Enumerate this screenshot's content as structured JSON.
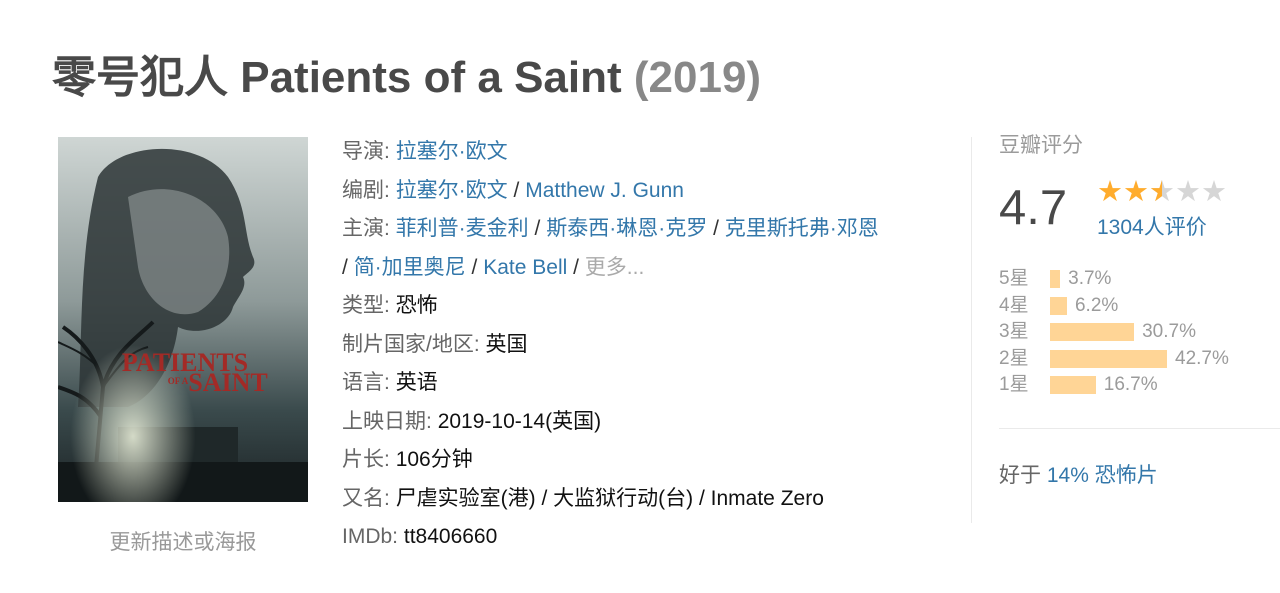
{
  "title": {
    "name": "零号犯人 Patients of a Saint",
    "year": "(2019)"
  },
  "poster": {
    "line1": "PATIENTS",
    "line2": "OF A",
    "line3": "SAINT",
    "update_link": "更新描述或海报"
  },
  "info": {
    "director_label": "导演:",
    "director": "拉塞尔·欧文",
    "writer_label": "编剧:",
    "writers": [
      "拉塞尔·欧文",
      "Matthew J. Gunn"
    ],
    "cast_label": "主演:",
    "cast": [
      "菲利普·麦金利",
      "斯泰西·琳恩·克罗",
      "克里斯托弗·邓恩",
      "简·加里奥尼",
      "Kate Bell"
    ],
    "cast_more": "更多...",
    "genre_label": "类型:",
    "genre": "恐怖",
    "country_label": "制片国家/地区:",
    "country": "英国",
    "language_label": "语言:",
    "language": "英语",
    "release_label": "上映日期:",
    "release": "2019-10-14(英国)",
    "runtime_label": "片长:",
    "runtime": "106分钟",
    "aka_label": "又名:",
    "aka": "尸虐实验室(港) / 大监狱行动(台) / Inmate Zero",
    "imdb_label": "IMDb:",
    "imdb": "tt8406660"
  },
  "rating": {
    "header": "豆瓣评分",
    "score": "4.7",
    "stars_value": 2.5,
    "votes": "1304人评价",
    "distribution": [
      {
        "label": "5星",
        "pct_text": "3.7%",
        "pct": 3.7
      },
      {
        "label": "4星",
        "pct_text": "6.2%",
        "pct": 6.2
      },
      {
        "label": "3星",
        "pct_text": "30.7%",
        "pct": 30.7
      },
      {
        "label": "2星",
        "pct_text": "42.7%",
        "pct": 42.7
      },
      {
        "label": "1星",
        "pct_text": "16.7%",
        "pct": 16.7
      }
    ],
    "better_than_prefix": "好于",
    "better_than_link": "14% 恐怖片"
  },
  "colors": {
    "link": "#3377aa",
    "star": "#ffac2d",
    "bar": "#ffd596"
  }
}
